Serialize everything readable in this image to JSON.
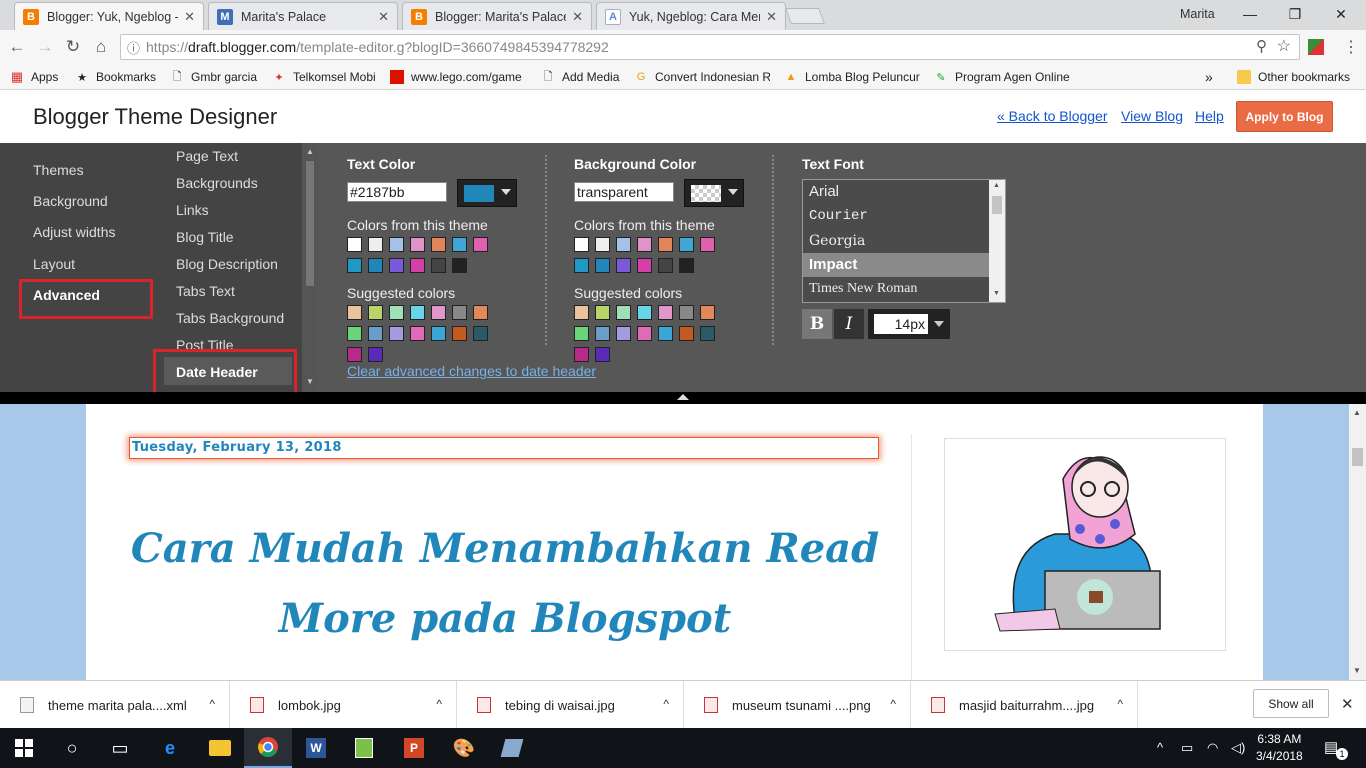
{
  "browser": {
    "tabs": [
      {
        "title": "Blogger: Yuk, Ngeblog - T",
        "icon": "blogger-icon",
        "active": true
      },
      {
        "title": "Marita's Palace",
        "icon": "blog-favicon",
        "active": false
      },
      {
        "title": "Blogger: Marita's Palace",
        "icon": "blogger-icon",
        "active": false
      },
      {
        "title": "Yuk, Ngeblog: Cara Mem",
        "icon": "blog-favicon",
        "active": false
      }
    ],
    "user": "Marita",
    "url_prefix": "https://",
    "url_host": "draft.blogger.com",
    "url_path": "/template-editor.g?blogID=3660749845394778292",
    "bookmarks": [
      {
        "label": "Apps"
      },
      {
        "label": "Bookmarks"
      },
      {
        "label": "Gmbr garcia"
      },
      {
        "label": "Telkomsel Mobi"
      },
      {
        "label": "www.lego.com/game"
      },
      {
        "label": "Add Media"
      },
      {
        "label": "Convert Indonesian R"
      },
      {
        "label": "Lomba Blog Peluncur"
      },
      {
        "label": "Program Agen Online"
      }
    ],
    "more_bookmarks": "»",
    "other_bookmarks": "Other bookmarks"
  },
  "designer": {
    "title": "Blogger Theme Designer",
    "back_link": "« Back to Blogger",
    "view_blog": "View Blog",
    "help": "Help",
    "apply": "Apply to Blog",
    "left_nav": [
      "Themes",
      "Background",
      "Adjust widths",
      "Layout",
      "Advanced"
    ],
    "sub_nav": [
      "Page Text",
      "Backgrounds",
      "Links",
      "Blog Title",
      "Blog Description",
      "Tabs Text",
      "Tabs Background",
      "Post Title",
      "Date Header"
    ],
    "text_color": {
      "title": "Text Color",
      "value": "#2187bb",
      "swatch": "#2187bb"
    },
    "background_color": {
      "title": "Background Color",
      "value": "transparent"
    },
    "colors_from_theme_label": "Colors from this theme",
    "suggested_colors_label": "Suggested colors",
    "theme_colors": [
      "#ffffff",
      "#eeeeee",
      "#a4c2e8",
      "#e093c8",
      "#e0865a",
      "#3fa6d6",
      "#e060b0",
      "#2197c4",
      "#2187bb",
      "#7a5ad8",
      "#d43fa8",
      "#444444",
      "#222222"
    ],
    "suggested_colors": [
      "#e8c39e",
      "#b9d46a",
      "#9ee0b8",
      "#6ad4e8",
      "#e096c8",
      "#888888",
      "#e08a5a",
      "#6ad47a",
      "#6a9ec8",
      "#a49ae0",
      "#e06ab8",
      "#3aa6d8",
      "#c45a20",
      "#2a5a6a",
      "#b82a8a",
      "#5a2ab8"
    ],
    "text_font": {
      "title": "Text Font",
      "fonts": [
        "Arial",
        "Courier",
        "Georgia",
        "Impact",
        "Times New Roman"
      ],
      "selected": "Impact",
      "bold": "B",
      "italic": "I",
      "size": "14px"
    },
    "clear_link": "Clear advanced changes to date header"
  },
  "preview": {
    "date_header": "Tuesday, February 13, 2018",
    "post_title": "Cara Mudah Menambahkan Read More pada Blogspot"
  },
  "downloads": {
    "items": [
      {
        "name": "theme marita pala....xml",
        "kind": "xml"
      },
      {
        "name": "lombok.jpg",
        "kind": "image"
      },
      {
        "name": "tebing di waisai.jpg",
        "kind": "image"
      },
      {
        "name": "museum tsunami ....png",
        "kind": "image"
      },
      {
        "name": "masjid baiturrahm....jpg",
        "kind": "image"
      }
    ],
    "show_all": "Show all"
  },
  "taskbar": {
    "time": "6:38 AM",
    "date": "3/4/2018",
    "notification_count": "1"
  }
}
